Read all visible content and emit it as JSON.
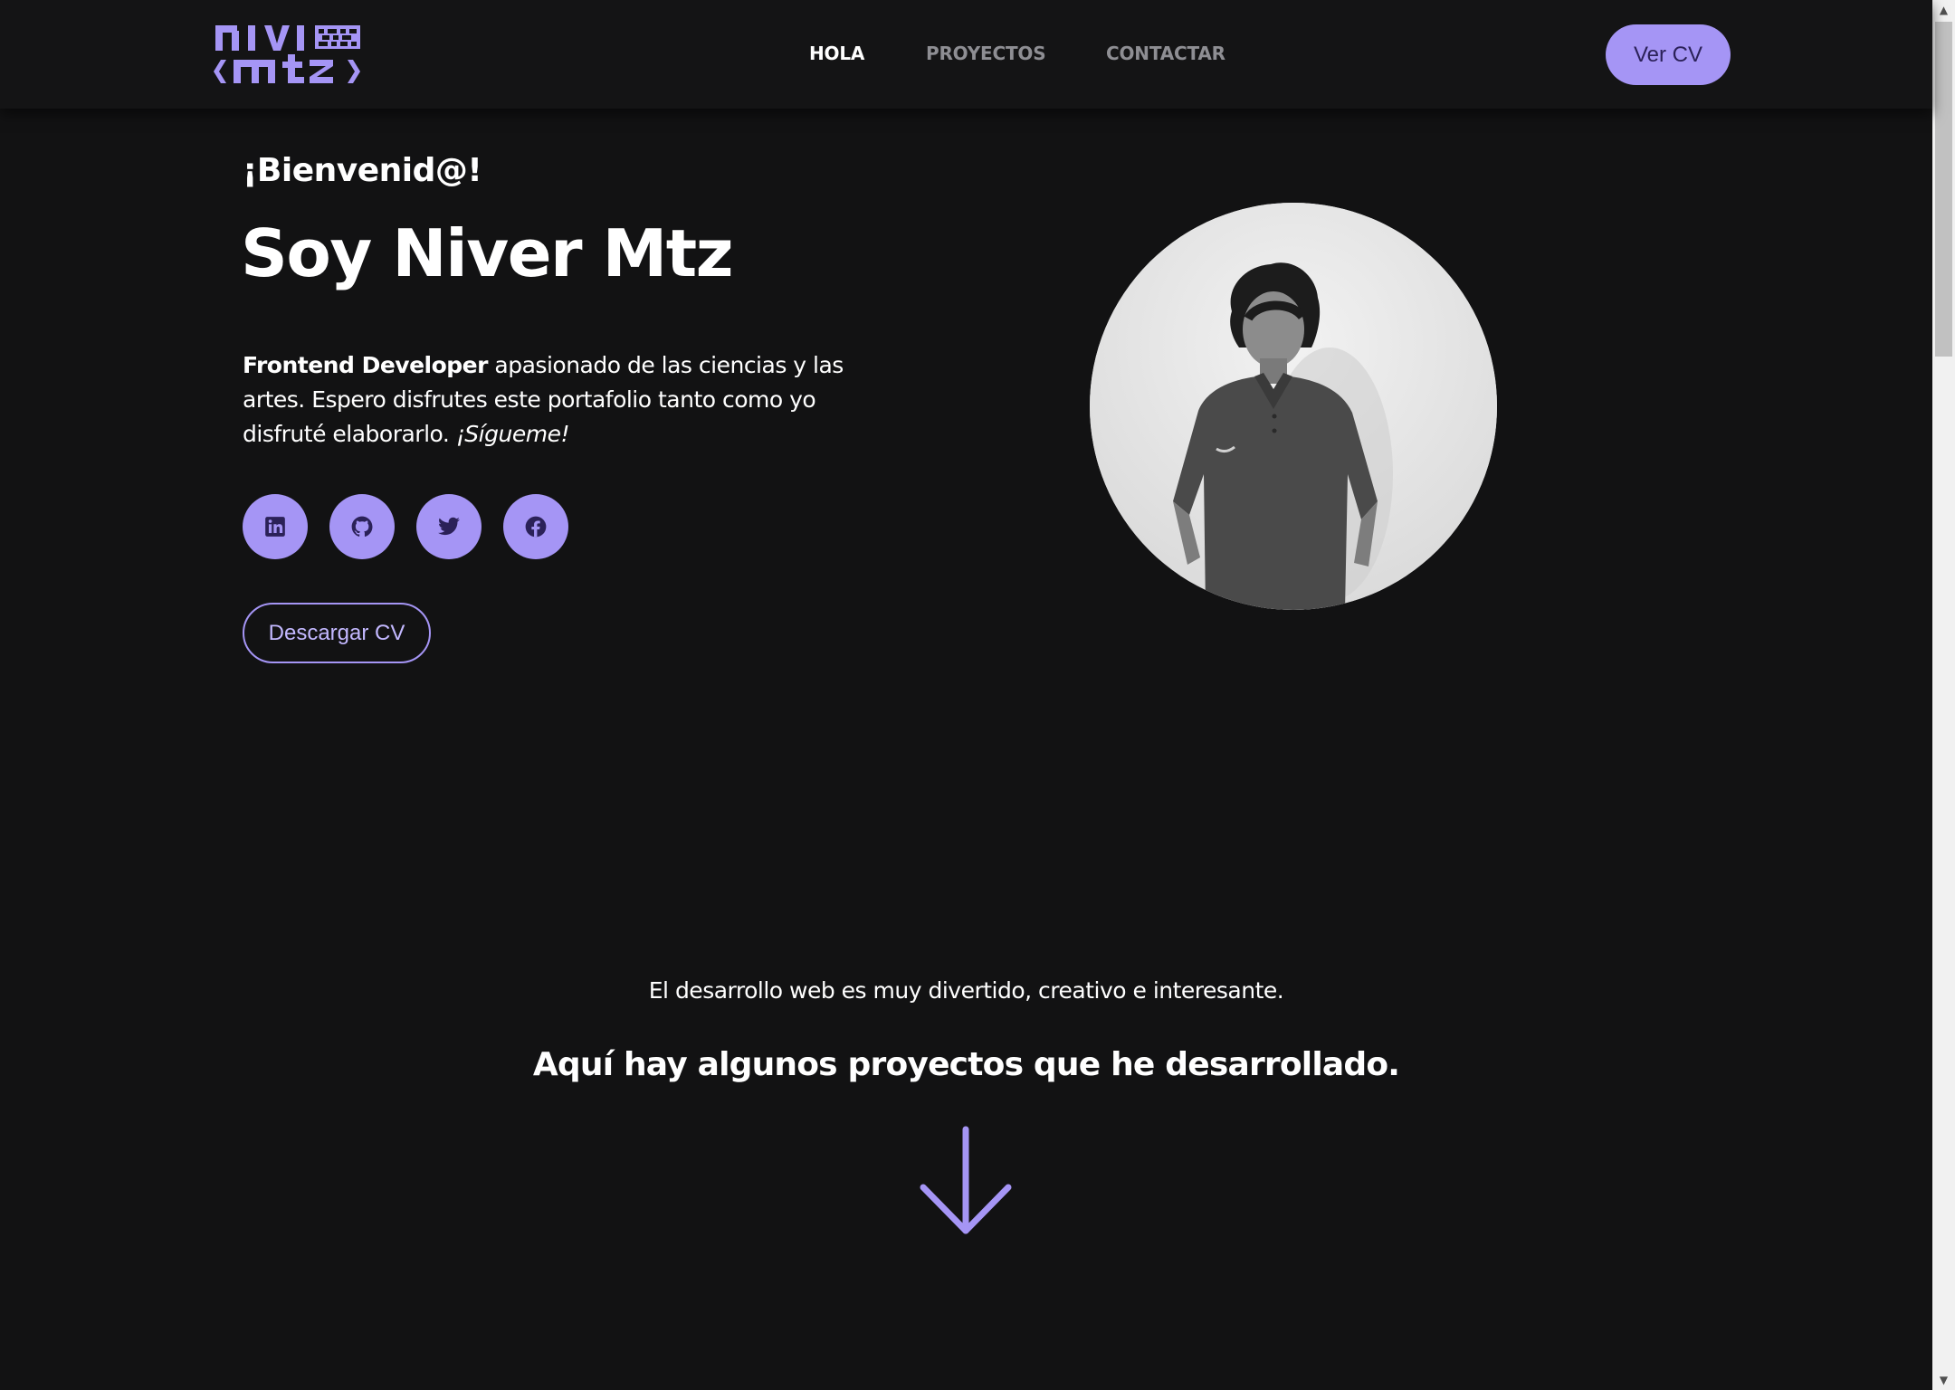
{
  "header": {
    "logo_alt": "nivl mtz",
    "nav": [
      {
        "label": "HOLA",
        "active": true
      },
      {
        "label": "PROYECTOS",
        "active": false
      },
      {
        "label": "CONTACTAR",
        "active": false
      }
    ],
    "cv_button": "Ver CV"
  },
  "hero": {
    "greeting": "¡Bienvenid@!",
    "title": "Soy Niver Mtz",
    "description_strong": "Frontend Developer",
    "description_text": " apasionado de las ciencias y las artes. Espero disfrutes este portafolio tanto como yo disfruté elaborarlo. ",
    "description_em": "¡Sígueme!",
    "socials": [
      {
        "icon": "linkedin-icon"
      },
      {
        "icon": "github-icon"
      },
      {
        "icon": "twitter-icon"
      },
      {
        "icon": "facebook-icon"
      }
    ],
    "download_button": "Descargar CV"
  },
  "projects_intro": {
    "text": "El desarrollo web es muy divertido, creativo e interesante.",
    "heading": "Aquí hay algunos proyectos que he desarrollado."
  },
  "colors": {
    "background": "#121213",
    "accent": "#a595f5",
    "nav_inactive": "#8e8e93"
  }
}
